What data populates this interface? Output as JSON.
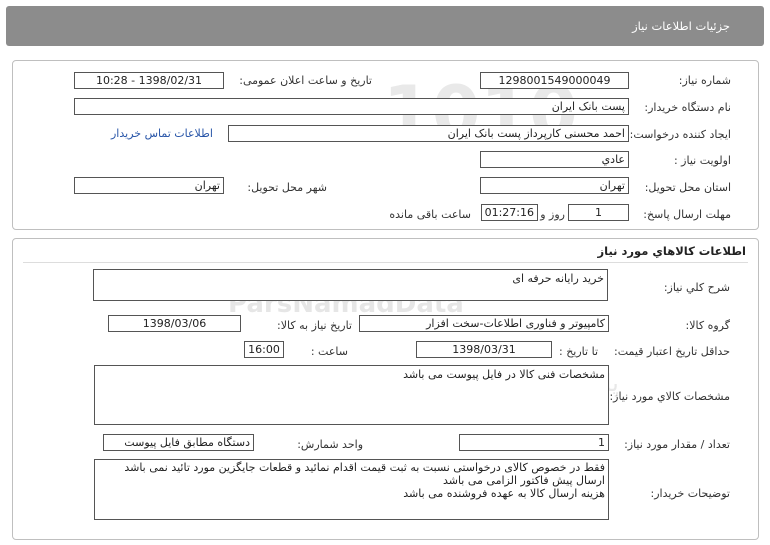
{
  "header": {
    "title": "جزئیات اطلاعات نیاز"
  },
  "need_info": {
    "need_number_label": "شماره نیاز:",
    "need_number": "1298001549000049",
    "announce_label": "تاریخ و ساعت اعلان عمومی:",
    "announce_value": "1398/02/31 - 10:28",
    "buyer_org_label": "نام دستگاه خریدار:",
    "buyer_org": "پست بانک ایران",
    "creator_label": "ایجاد کننده درخواست:",
    "creator": "احمد  محسنی کارپرداز پست بانک ایران",
    "contact_link": "اطلاعات تماس خریدار",
    "priority_label": "اولویت نیاز :",
    "priority": "عادي",
    "province_label": "استان محل تحویل:",
    "province": "تهران",
    "city_label": "شهر محل تحویل:",
    "city": "تهران",
    "deadline_label": "مهلت ارسال پاسخ:",
    "deadline_days": "1",
    "days_word": "روز و",
    "deadline_time": "01:27:16",
    "remaining_label": "ساعت باقی مانده"
  },
  "goods": {
    "title": "اطلاعات کالاهاي مورد نياز",
    "summary_label": "شرح کلي نياز:",
    "summary": "خرید رایانه حرفه ای",
    "group_label": "گروه کالا:",
    "group": "کامپیوتر و فناوری اطلاعات-سخت افزار",
    "need_date_label": "تاریخ نیاز به کالا:",
    "need_date": "1398/03/06",
    "validity_label": "حداقل تاریخ اعتبار قیمت:",
    "until_date_label": "تا تاریخ :",
    "validity_date": "1398/03/31",
    "time_label": "ساعت :",
    "validity_time": "16:00",
    "specs_label": "مشخصات کالاي مورد نياز:",
    "specs": "مشخصات فنی کالا در فایل پیوست می باشد",
    "qty_label": "تعداد / مقدار مورد نیاز:",
    "qty": "1",
    "unit_label": "واحد شمارش:",
    "unit": "دستگاه مطابق فایل پیوست",
    "notes_label": "توضیحات خریدار:",
    "notes_1": "فقط در خصوص کالای درخواستی نسبت به ثبت قیمت اقدام نمائید و قطعات جایگزین مورد تائید نمی باشد",
    "notes_2": "ارسال پیش فاکتور الزامی می باشد",
    "notes_3": "هزینه ارسال کالا به عهده فروشنده می باشد"
  }
}
